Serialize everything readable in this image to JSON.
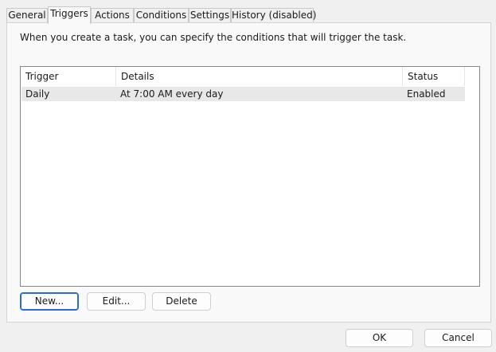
{
  "tabs": [
    {
      "label": "General"
    },
    {
      "label": "Triggers",
      "active": true
    },
    {
      "label": "Actions"
    },
    {
      "label": "Conditions"
    },
    {
      "label": "Settings"
    },
    {
      "label": "History (disabled)"
    }
  ],
  "triggers_panel": {
    "intro_text": "When you create a task, you can specify the conditions that will trigger the task.",
    "columns": [
      "Trigger",
      "Details",
      "Status"
    ],
    "rows": [
      {
        "trigger": "Daily",
        "details": "At 7:00 AM every day",
        "status": "Enabled",
        "selected": true
      }
    ],
    "buttons": {
      "new": "New...",
      "edit": "Edit...",
      "delete": "Delete"
    }
  },
  "dialog_buttons": {
    "ok": "OK",
    "cancel": "Cancel"
  },
  "colors": {
    "selected_row": "#e8e8e8",
    "default_button_border": "#2a6ad2"
  }
}
